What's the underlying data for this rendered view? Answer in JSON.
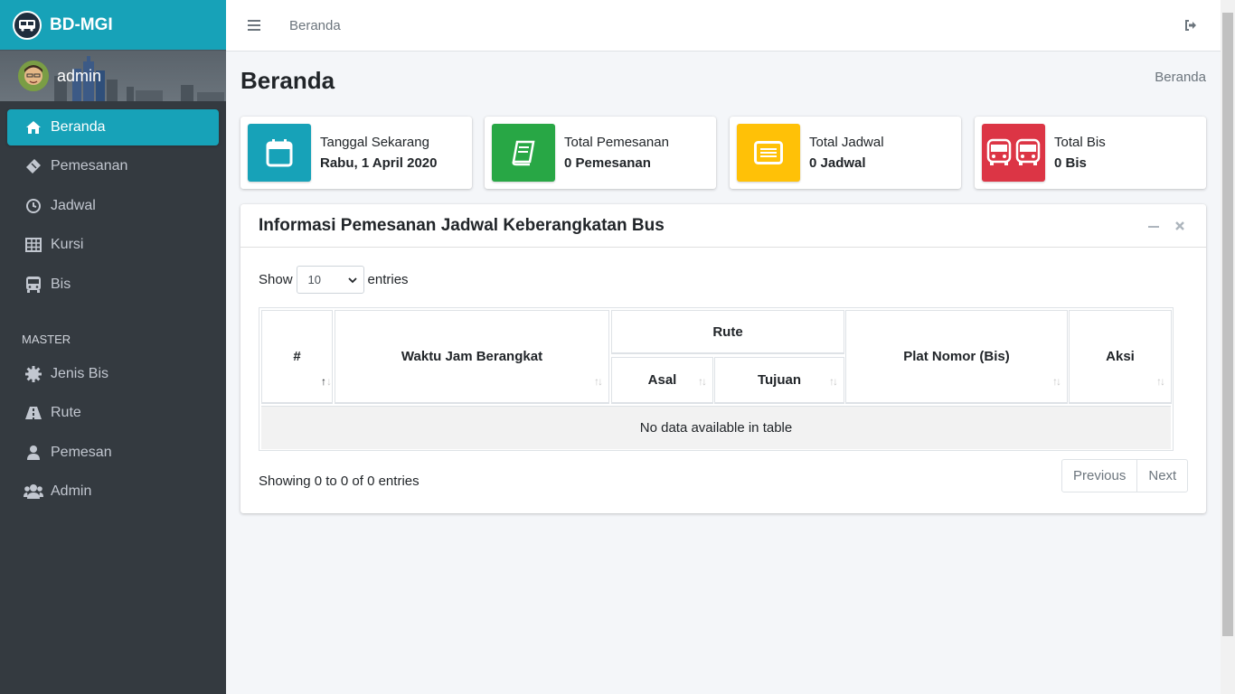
{
  "brand": {
    "name": "BD-MGI"
  },
  "user": {
    "name": "admin"
  },
  "sidebar": {
    "items": [
      {
        "label": "Beranda",
        "icon": "home-icon"
      },
      {
        "label": "Pemesanan",
        "icon": "ticket-icon"
      },
      {
        "label": "Jadwal",
        "icon": "clock-icon"
      },
      {
        "label": "Kursi",
        "icon": "table-icon"
      },
      {
        "label": "Bis",
        "icon": "bus-icon"
      }
    ],
    "master_header": "MASTER",
    "master_items": [
      {
        "label": "Jenis Bis",
        "icon": "cog-icon"
      },
      {
        "label": "Rute",
        "icon": "road-icon"
      },
      {
        "label": "Pemesan",
        "icon": "user-icon"
      },
      {
        "label": "Admin",
        "icon": "users-icon"
      }
    ]
  },
  "topbar": {
    "link": "Beranda"
  },
  "content": {
    "title": "Beranda",
    "breadcrumb": "Beranda"
  },
  "info_boxes": [
    {
      "label": "Tanggal Sekarang",
      "value": "Rabu, 1 April 2020",
      "color": "#17a2b8",
      "icon": "calendar-icon"
    },
    {
      "label": "Total Pemesanan",
      "value": "0 Pemesanan",
      "color": "#28a745",
      "icon": "book-icon"
    },
    {
      "label": "Total Jadwal",
      "value": "0 Jadwal",
      "color": "#ffc107",
      "icon": "list-icon"
    },
    {
      "label": "Total Bis",
      "value": "0 Bis",
      "color": "#dc3545",
      "icon": "bus-icon"
    }
  ],
  "card": {
    "title": "Informasi Pemesanan Jadwal Keberangkatan Bus",
    "show_label": "Show",
    "entries_label": "entries",
    "page_length": "10",
    "columns": {
      "num": "#",
      "waktu": "Waktu Jam Berangkat",
      "rute": "Rute",
      "asal": "Asal",
      "tujuan": "Tujuan",
      "plat": "Plat Nomor (Bis)",
      "aksi": "Aksi"
    },
    "empty": "No data available in table",
    "showing": "Showing 0 to 0 of 0 entries",
    "previous": "Previous",
    "next": "Next"
  },
  "colors": {
    "accent": "#17a2b8",
    "sidebar_bg": "#343a40"
  }
}
